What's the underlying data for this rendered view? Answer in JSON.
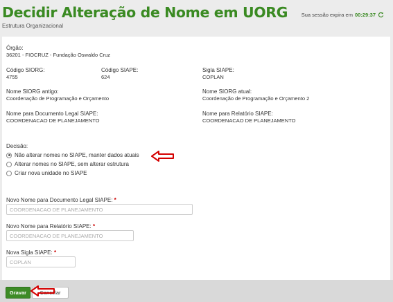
{
  "header": {
    "title": "Decidir Alteração de Nome em UORG",
    "subtitle": "Estrutura Organizacional",
    "session_label": "Sua sessão expira em",
    "session_timer": "00:29:37"
  },
  "info": {
    "orgao_label": "Órgão:",
    "orgao_value": "36201 - FIOCRUZ - Fundação Oswaldo Cruz",
    "codigo_siorg_label": "Código SIORG:",
    "codigo_siorg_value": "4755",
    "codigo_siape_label": "Código SIAPE:",
    "codigo_siape_value": "624",
    "sigla_siape_label": "Sigla SIAPE:",
    "sigla_siape_value": "COPLAN",
    "nome_siorg_antigo_label": "Nome SIORG antigo:",
    "nome_siorg_antigo_value": "Coordenação de Programação e Orçamento",
    "nome_siorg_atual_label": "Nome SIORG atual:",
    "nome_siorg_atual_value": "Coordenação de Programação e Orçamento 2",
    "nome_doc_legal_label": "Nome para Documento Legal SIAPE:",
    "nome_doc_legal_value": "COORDENACAO DE PLANEJAMENTO",
    "nome_relatorio_label": "Nome para Relatório SIAPE:",
    "nome_relatorio_value": "COORDENACAO DE PLANEJAMENTO"
  },
  "decision": {
    "label": "Decisão:",
    "options": [
      {
        "label": "Não alterar nomes no SIAPE, manter dados atuais",
        "checked": true
      },
      {
        "label": "Alterar nomes no SIAPE, sem alterar estrutura",
        "checked": false
      },
      {
        "label": "Criar nova unidade no SIAPE",
        "checked": false
      }
    ]
  },
  "form": {
    "novo_nome_doc_label": "Novo Nome para Documento Legal SIAPE:",
    "novo_nome_doc_placeholder": "COORDENACAO DE PLANEJAMENTO",
    "novo_nome_rel_label": "Novo Nome para Relatório SIAPE:",
    "novo_nome_rel_placeholder": "COORDENACAO DE PLANEJAMENTO",
    "nova_sigla_label": "Nova Sigla SIAPE:",
    "nova_sigla_placeholder": "COPLAN",
    "required_mark": "*"
  },
  "footer": {
    "save_label": "Gravar",
    "cancel_label": "Cancelar"
  },
  "colors": {
    "brand_green": "#3a8a22",
    "annotation_red": "#d40000"
  }
}
